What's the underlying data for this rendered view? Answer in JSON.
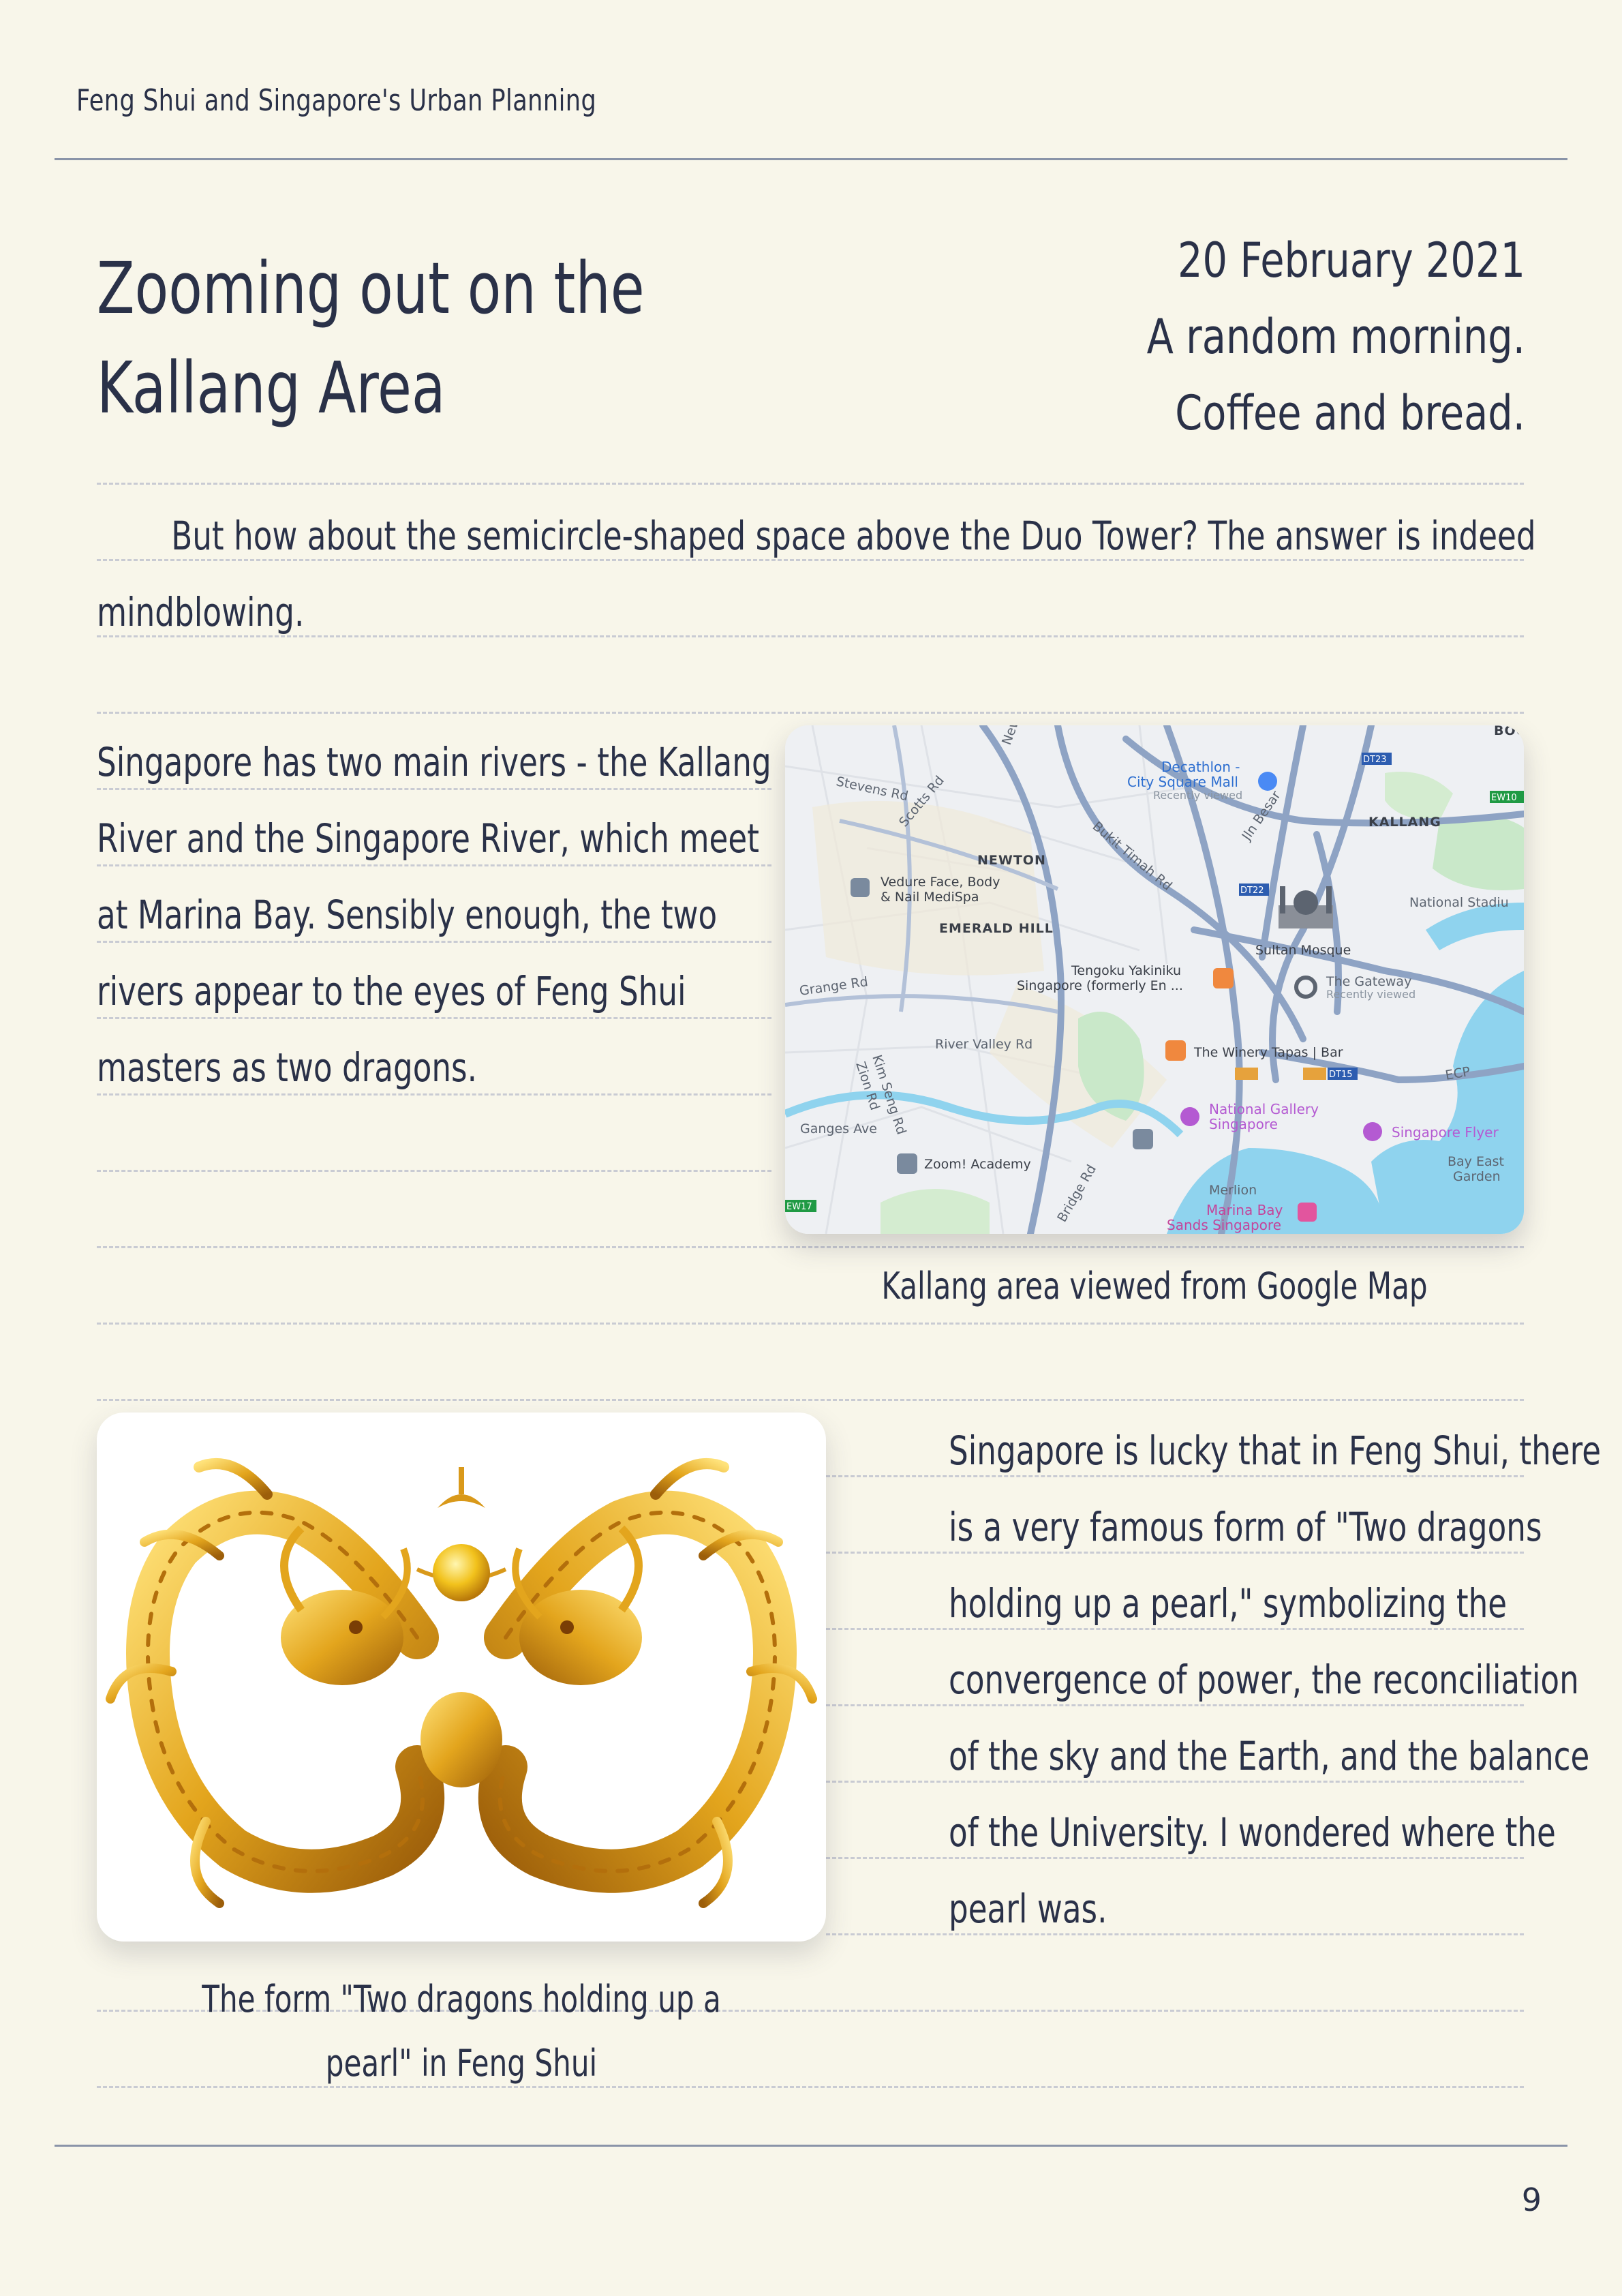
{
  "header": {
    "running_title": "Feng Shui and Singapore's Urban Planning"
  },
  "title": {
    "line1": "Zooming out on the",
    "line2": "Kallang Area"
  },
  "meta": {
    "date": "20 February 2021",
    "line2": "A random morning.",
    "line3": "Coffee and bread."
  },
  "intro": "But how about the semicircle-shaped space above the Duo Tower? The answer is indeed mindblowing.",
  "rivers_text": "Singapore has two main rivers - the Kallang River and the Singapore River, which meet at Marina Bay. Sensibly enough, the two rivers appear to the eyes of Feng Shui masters as two dragons.",
  "map": {
    "caption": "Kallang area viewed from Google Map",
    "labels": {
      "decathlon": "Decathlon -",
      "city_square": "City Square Mall",
      "recently_viewed": "Recently viewed",
      "kallang": "KALLANG",
      "newton": "NEWTON",
      "vedure1": "Vedure Face, Body",
      "vedure2": "& Nail MediSpa",
      "emerald": "EMERALD HILL",
      "sultan": "Sultan Mosque",
      "national_stadium": "National Stadiu",
      "tengoku1": "Tengoku Yakiniku",
      "tengoku2": "Singapore (formerly En ...",
      "gateway": "The Gateway",
      "gateway_sub": "Recently viewed",
      "winery": "The Winery Tapas | Bar",
      "national_gallery1": "National Gallery",
      "national_gallery2": "Singapore",
      "flyer": "Singapore Flyer",
      "bay_east1": "Bay East",
      "bay_east2": "Garden",
      "zoom": "Zoom! Academy",
      "merlion": "Merlion",
      "mbs1": "Marina Bay",
      "mbs2": "Sands Singapore",
      "ganges": "Ganges Ave",
      "grange": "Grange Rd",
      "river_valley": "River Valley Rd",
      "kim_seng": "Kim Seng Rd",
      "zion": "Zion Rd",
      "stevens": "Stevens Rd",
      "scotts": "Scotts Rd",
      "bukit_timah": "Bukit Timah Rd",
      "jln_besar": "Jln Besar",
      "newton_rd": "Newto",
      "boo": "BOO",
      "ecp": "ECP",
      "bridge": "Bridge Rd",
      "dt23": "DT23",
      "dt22": "DT22",
      "dt15": "DT15",
      "ew10": "EW10",
      "ew17": "EW17"
    }
  },
  "dragon": {
    "caption_line1": "The form \"Two dragons holding up a",
    "caption_line2": "pearl\" in Feng Shui"
  },
  "pearl_text": "Singapore is lucky that in Feng Shui, there is a very famous form of \"Two dragons holding up a pearl,\" symbolizing the convergence of power, the reconciliation of the sky and the Earth, and the balance of the University. I wondered where the pearl was.",
  "page_number": "9",
  "colors": {
    "background": "#f8f6ea",
    "text": "#2a3148",
    "rule": "#8a94a8",
    "water": "#8fd3ee",
    "gold": "#e0a91e"
  }
}
